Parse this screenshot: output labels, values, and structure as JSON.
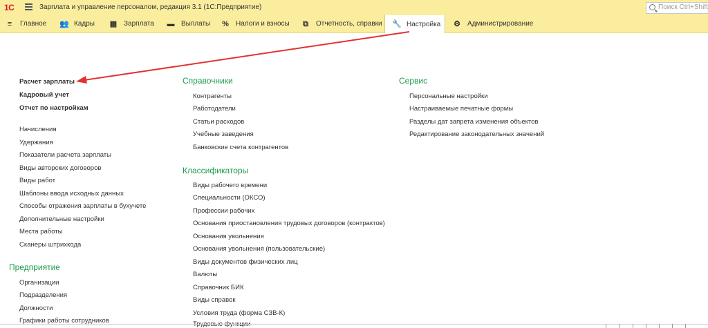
{
  "app": {
    "logo": "1С",
    "title": "Зарплата и управление персоналом, редакция 3.1  (1С:Предприятие)"
  },
  "search": {
    "placeholder": "Поиск Ctrl+Shift+"
  },
  "sections": [
    {
      "label": "Главное",
      "icon": "menu-lines-icon"
    },
    {
      "label": "Кадры",
      "icon": "people-icon"
    },
    {
      "label": "Зарплата",
      "icon": "calculator-icon"
    },
    {
      "label": "Выплаты",
      "icon": "wallet-icon"
    },
    {
      "label": "Налоги и взносы",
      "icon": "percent-icon"
    },
    {
      "label": "Отчетность, справки",
      "icon": "documents-icon"
    },
    {
      "label": "Настройка",
      "icon": "wrench-icon",
      "active": true
    },
    {
      "label": "Администрирование",
      "icon": "gear-icon"
    }
  ],
  "left": {
    "top_links": [
      "Расчет зарплаты",
      "Кадровый учет",
      "Отчет по настройкам"
    ],
    "links": [
      "Начисления",
      "Удержания",
      "Показатели расчета зарплаты",
      "Виды авторских договоров",
      "Виды работ",
      "Шаблоны ввода исходных данных",
      "Способы отражения зарплаты в бухучете",
      "Дополнительные настройки",
      "Места работы",
      "Сканеры штрихкода"
    ],
    "enterprise_title": "Предприятие",
    "enterprise_links": [
      "Организации",
      "Подразделения",
      "Должности",
      "Графики работы сотрудников"
    ]
  },
  "middle": {
    "ref_title": "Справочники",
    "ref_links": [
      "Контрагенты",
      "Работодатели",
      "Статьи расходов",
      "Учебные заведения",
      "Банковские счета контрагентов"
    ],
    "cls_title": "Классификаторы",
    "cls_links": [
      "Виды рабочего времени",
      "Специальности (ОКСО)",
      "Профессии рабочих",
      "Основания приостановления трудовых договоров (контрактов)",
      "Основания увольнения",
      "Основания увольнения (пользовательские)",
      "Виды документов физических лиц",
      "Валюты",
      "Справочник БИК",
      "Виды справок",
      "Условия труда (форма СЗВ-К)",
      "Трудовые функции"
    ]
  },
  "right": {
    "title": "Сервис",
    "links": [
      "Персональные настройки",
      "Настраиваемые печатные формы",
      "Разделы дат запрета изменения объектов",
      "Редактирование законодательных значений"
    ]
  },
  "colors": {
    "accent_green": "#1f9a4e",
    "panel_yellow": "#fbed9e",
    "arrow_red": "#e53030"
  }
}
